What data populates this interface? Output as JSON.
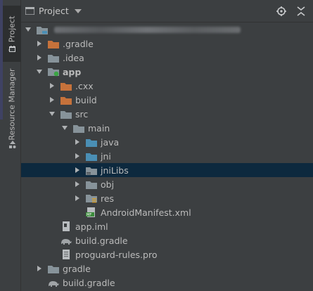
{
  "sidebar": {
    "tab_project": "1: Project",
    "tab_resource_manager": "Resource Manager"
  },
  "header": {
    "title": "Project"
  },
  "colors": {
    "folder_plain": "#87939a",
    "folder_excluded": "#c6723b",
    "folder_source": "#4a8fb5",
    "selection": "#0d293e"
  },
  "tree": {
    "root_blurred": "",
    "gradle_dir": ".gradle",
    "idea_dir": ".idea",
    "app": "app",
    "cxx": ".cxx",
    "build": "build",
    "src": "src",
    "main": "main",
    "java": "java",
    "jni": "jni",
    "jnilibs": "jniLibs",
    "obj": "obj",
    "res": "res",
    "manifest": "AndroidManifest.xml",
    "app_iml": "app.iml",
    "app_build_gradle": "build.gradle",
    "proguard": "proguard-rules.pro",
    "gradle": "gradle",
    "root_build_gradle": "build.gradle"
  }
}
